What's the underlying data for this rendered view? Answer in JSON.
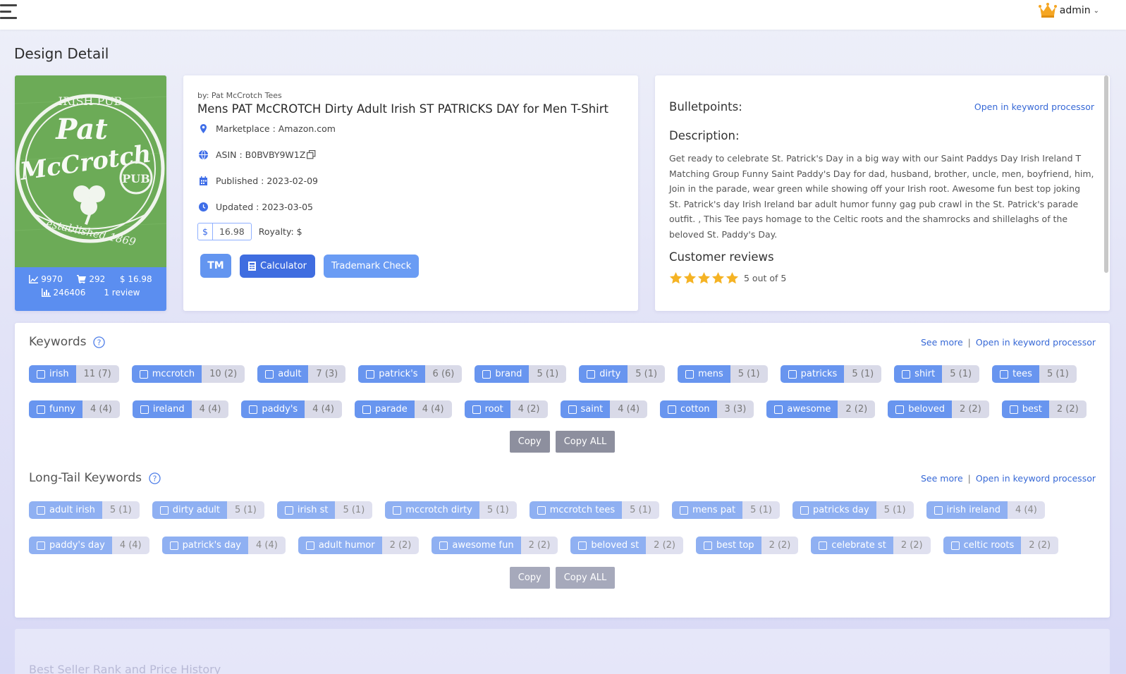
{
  "header": {
    "user_name": "admin"
  },
  "page": {
    "title": "Design Detail"
  },
  "design": {
    "image_text": {
      "top": "IRISH PUB",
      "name1": "Pat",
      "name2": "McCrotch",
      "badge": "PUB",
      "bottom": "established 1869"
    },
    "stats": {
      "trend": "9970",
      "sales": "292",
      "price": "$ 16.98",
      "rank": "246406",
      "reviews": "1 review"
    }
  },
  "product": {
    "by_line": "by: Pat McCrotch Tees",
    "title": "Mens PAT McCROTCH Dirty Adult Irish ST PATRICKS DAY for Men T-Shirt",
    "marketplace": "Marketplace : Amazon.com",
    "asin": "ASIN : B0BVBY9W1Z",
    "published": "Published : 2023-02-09",
    "updated": "Updated : 2023-03-05",
    "currency_symbol": "$",
    "price_value": "16.98",
    "royalty": "Royalty: $",
    "tm_label": "TM",
    "calculator_label": "Calculator",
    "trademark_label": "Trademark Check"
  },
  "details": {
    "bulletpoints_heading": "Bulletpoints:",
    "open_processor": "Open in keyword processor",
    "description_heading": "Description:",
    "description": "Get ready to celebrate St. Patrick's Day in a big way with our Saint Paddys Day Irish Ireland T Matching Group Funny Saint Paddy's Day for dad, husband, brother, uncle, men, boyfriend, him, Join in the parade, wear green while showing off your Irish root. Awesome fun best top joking St. Patrick's day Irish Ireland bar adult humor funny gag pub crawl in the St. Patrick's parade outfit. , This Tee pays homage to the Celtic roots and the shamrocks and shillelaghs of the beloved St. Paddy's Day.",
    "reviews_heading": "Customer reviews",
    "rating_text": "5 out of 5",
    "rating": 5,
    "star_color": "#f5b324"
  },
  "keywords": {
    "title": "Keywords",
    "see_more": "See more",
    "separator": "|",
    "open_processor": "Open in keyword processor",
    "items": [
      {
        "label": "irish",
        "count": "11 (7)"
      },
      {
        "label": "mccrotch",
        "count": "10 (2)"
      },
      {
        "label": "adult",
        "count": "7 (3)"
      },
      {
        "label": "patrick's",
        "count": "6 (6)"
      },
      {
        "label": "brand",
        "count": "5 (1)"
      },
      {
        "label": "dirty",
        "count": "5 (1)"
      },
      {
        "label": "mens",
        "count": "5 (1)"
      },
      {
        "label": "patricks",
        "count": "5 (1)"
      },
      {
        "label": "shirt",
        "count": "5 (1)"
      },
      {
        "label": "tees",
        "count": "5 (1)"
      },
      {
        "label": "funny",
        "count": "4 (4)"
      },
      {
        "label": "ireland",
        "count": "4 (4)"
      },
      {
        "label": "paddy's",
        "count": "4 (4)"
      },
      {
        "label": "parade",
        "count": "4 (4)"
      },
      {
        "label": "root",
        "count": "4 (2)"
      },
      {
        "label": "saint",
        "count": "4 (4)"
      },
      {
        "label": "cotton",
        "count": "3 (3)"
      },
      {
        "label": "awesome",
        "count": "2 (2)"
      },
      {
        "label": "beloved",
        "count": "2 (2)"
      },
      {
        "label": "best",
        "count": "2 (2)"
      }
    ],
    "copy_label": "Copy",
    "copy_all_label": "Copy ALL"
  },
  "longtail": {
    "title": "Long-Tail Keywords",
    "see_more": "See more",
    "separator": "|",
    "open_processor": "Open in keyword processor",
    "items": [
      {
        "label": "adult irish",
        "count": "5 (1)"
      },
      {
        "label": "dirty adult",
        "count": "5 (1)"
      },
      {
        "label": "irish st",
        "count": "5 (1)"
      },
      {
        "label": "mccrotch dirty",
        "count": "5 (1)"
      },
      {
        "label": "mccrotch tees",
        "count": "5 (1)"
      },
      {
        "label": "mens pat",
        "count": "5 (1)"
      },
      {
        "label": "patricks day",
        "count": "5 (1)"
      },
      {
        "label": "irish ireland",
        "count": "4 (4)"
      },
      {
        "label": "paddy's day",
        "count": "4 (4)"
      },
      {
        "label": "patrick's day",
        "count": "4 (4)"
      },
      {
        "label": "adult humor",
        "count": "2 (2)"
      },
      {
        "label": "awesome fun",
        "count": "2 (2)"
      },
      {
        "label": "beloved st",
        "count": "2 (2)"
      },
      {
        "label": "best top",
        "count": "2 (2)"
      },
      {
        "label": "celebrate st",
        "count": "2 (2)"
      },
      {
        "label": "celtic roots",
        "count": "2 (2)"
      }
    ],
    "copy_label": "Copy",
    "copy_all_label": "Copy ALL"
  },
  "bottom_section": {
    "title": "Best Seller Rank and Price History"
  },
  "colors": {
    "accent": "#3f6ee8",
    "chip_blue": "#6895ef",
    "stats_blue": "#5b8ef0",
    "shirt_green": "#6cab57",
    "crown": "#f5a623"
  }
}
